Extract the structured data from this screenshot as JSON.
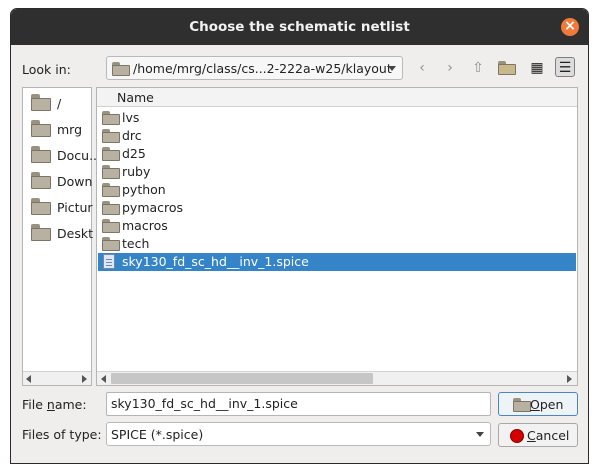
{
  "window": {
    "title": "Choose the schematic netlist"
  },
  "look_in": {
    "label": "Look in:",
    "path": "/home/mrg/class/cs...2-222a-w25/klayout"
  },
  "toolbar": {
    "back_icon": "‹",
    "forward_icon": "›",
    "up_icon": "⇧",
    "new_folder_icon": "★",
    "list_view_icon": "▦",
    "detail_view_icon": "☰"
  },
  "sidebar": {
    "items": [
      {
        "label": "/"
      },
      {
        "label": "mrg"
      },
      {
        "label": "Docu..."
      },
      {
        "label": "Down"
      },
      {
        "label": "Pictur"
      },
      {
        "label": "Deskt"
      }
    ]
  },
  "file_list": {
    "column_header": "Name",
    "items": [
      {
        "label": "lvs",
        "type": "folder"
      },
      {
        "label": "drc",
        "type": "folder"
      },
      {
        "label": "d25",
        "type": "folder"
      },
      {
        "label": "ruby",
        "type": "folder"
      },
      {
        "label": "python",
        "type": "folder"
      },
      {
        "label": "pymacros",
        "type": "folder"
      },
      {
        "label": "macros",
        "type": "folder"
      },
      {
        "label": "tech",
        "type": "folder"
      },
      {
        "label": "sky130_fd_sc_hd__inv_1.spice",
        "type": "file",
        "selected": true
      }
    ]
  },
  "file_name": {
    "label_prefix": "File ",
    "label_underlined": "n",
    "label_suffix": "ame:",
    "value": "sky130_fd_sc_hd__inv_1.spice"
  },
  "file_type": {
    "label": "Files of type:",
    "value": "SPICE (*.spice)"
  },
  "buttons": {
    "open_underlined": "O",
    "open_rest": "pen",
    "cancel_underlined": "C",
    "cancel_rest": "ancel"
  },
  "colors": {
    "selection": "#3584c8",
    "close_button": "#f07a3a",
    "titlebar": "#2f2f2f"
  }
}
